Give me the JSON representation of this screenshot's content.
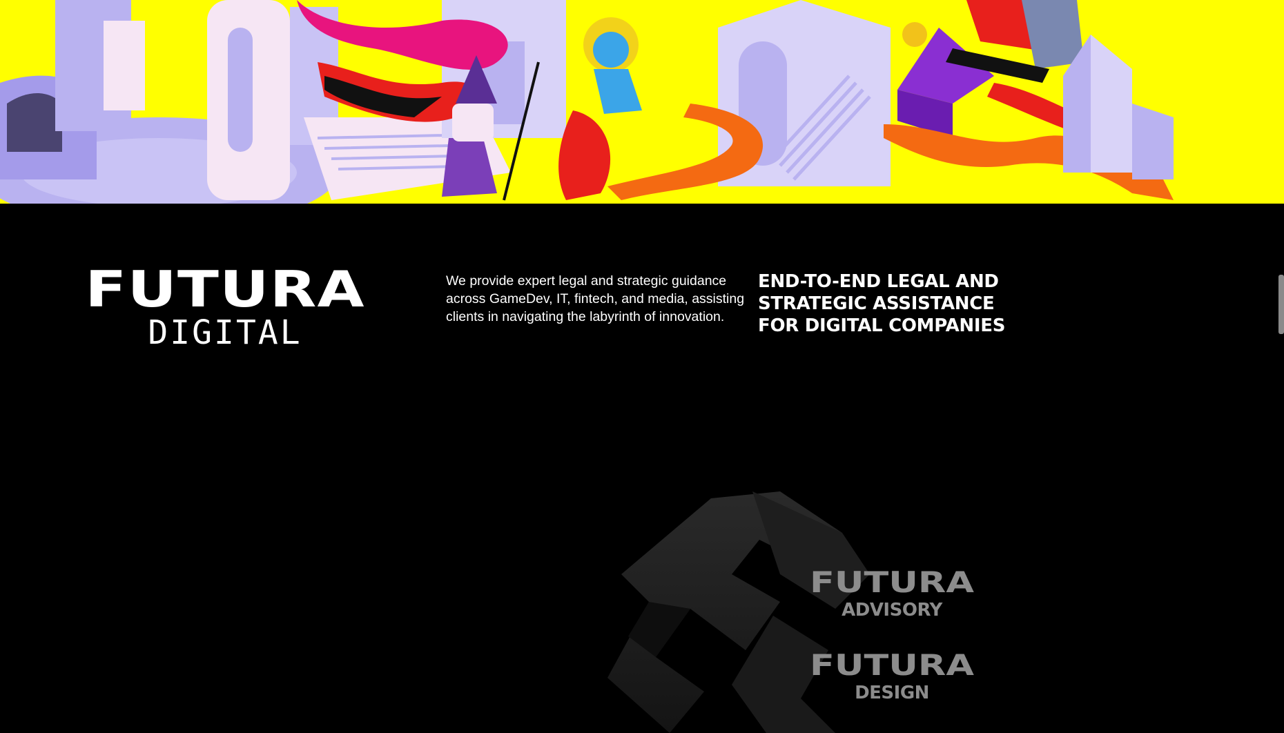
{
  "colors": {
    "background": "#000000",
    "hero_yellow": "#ffff00",
    "lavender": "#b9b2f0",
    "pale_pink": "#f6e6f4",
    "magenta": "#e8147e",
    "red": "#e8201c",
    "orange": "#f46a12",
    "purple": "#8a2fd2",
    "text_primary": "#ffffff",
    "text_muted": "#8c8c8c"
  },
  "hero": {
    "illustration": "isometric-labyrinth-illustration"
  },
  "brand": {
    "main": "FUTURA",
    "sub": "DIGITAL"
  },
  "description": "We provide expert legal and strategic guidance across GameDev, IT, fintech, and media, assisting clients in navigating the labyrinth of innovation.",
  "headline": "END-TO-END LEGAL AND STRATEGIC ASSISTANCE FOR DIGITAL COMPANIES",
  "subbrands": [
    {
      "main": "FUTURA",
      "sub": "ADVISORY"
    },
    {
      "main": "FUTURA",
      "sub": "DESIGN"
    }
  ],
  "icons": {
    "mark": "futura-3d-logo-mark-icon"
  }
}
